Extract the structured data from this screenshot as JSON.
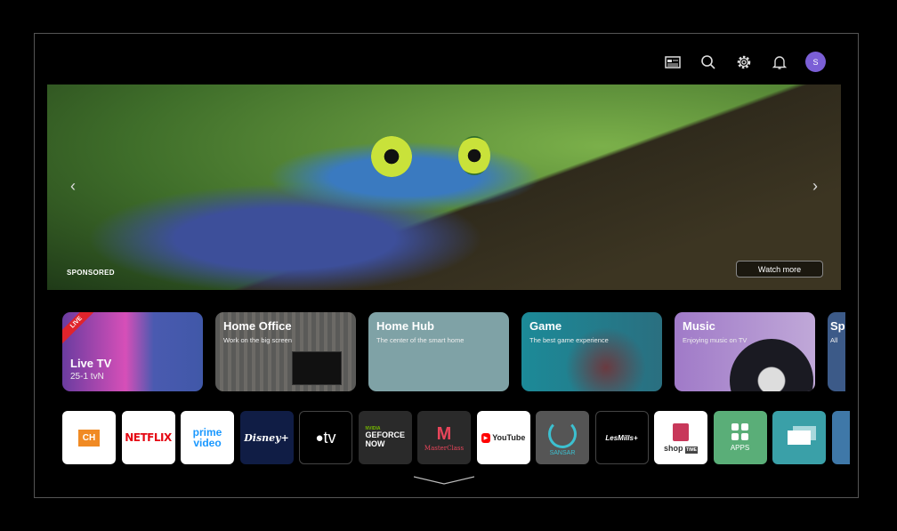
{
  "header": {
    "icons": [
      "guide-icon",
      "search-icon",
      "settings-gear-icon",
      "bell-icon"
    ],
    "avatar_letter": "S",
    "avatar_color": "#7b5fd6"
  },
  "hero": {
    "sponsored": "SPONSORED",
    "watch_more": "Watch more",
    "prev": "‹",
    "next": "›"
  },
  "cards": [
    {
      "title": "Live TV",
      "subtitle": "25-1  tvN",
      "badge": "LIVE"
    },
    {
      "title": "Home Office",
      "subtitle": "Work on the big screen"
    },
    {
      "title": "Home Hub",
      "subtitle": "The center of the smart home"
    },
    {
      "title": "Game",
      "subtitle": "The best game experience"
    },
    {
      "title": "Music",
      "subtitle": "Enjoying music on TV"
    },
    {
      "title": "Sp",
      "subtitle": "All"
    }
  ],
  "apps": [
    {
      "name": "CH"
    },
    {
      "name": "NETFLIX"
    },
    {
      "name": "prime video"
    },
    {
      "name": "Disney+"
    },
    {
      "name": "tv"
    },
    {
      "name": "GEFORCE NOW",
      "brand": "NVIDIA"
    },
    {
      "name": "MasterClass"
    },
    {
      "name": "YouTube"
    },
    {
      "name": "SANSAR"
    },
    {
      "name": "LesMills+"
    },
    {
      "name": "shop",
      "suffix": "TIME"
    },
    {
      "name": "APPS"
    },
    {
      "name": "screen-share"
    },
    {
      "name": "input"
    }
  ]
}
